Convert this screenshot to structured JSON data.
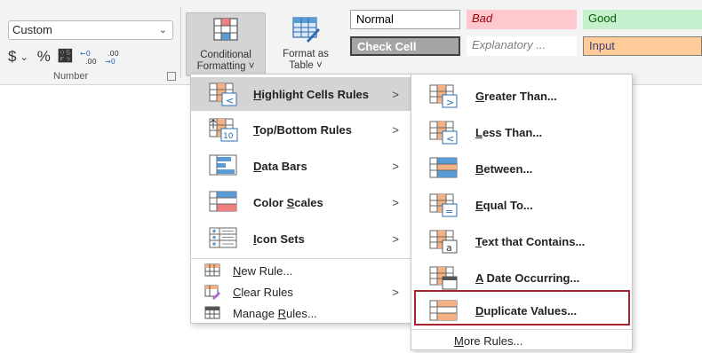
{
  "number_group": {
    "format_value": "Custom",
    "currency_symbol": "$",
    "percent_symbol": "%",
    "comma_symbol": "ȹ",
    "increase_decimal": "←.0 .00",
    "decrease_decimal": ".00 →.0",
    "label": "Number"
  },
  "ribbon": {
    "conditional_formatting_line1": "Conditional",
    "conditional_formatting_line2": "Formatting ˅",
    "format_as_table_line1": "Format as",
    "format_as_table_line2": "Table ˅"
  },
  "styles": {
    "normal": "Normal",
    "bad": "Bad",
    "good": "Good",
    "check_cell": "Check Cell",
    "explanatory": "Explanatory ...",
    "input": "Input"
  },
  "main_menu": {
    "items": [
      {
        "label": "Highlight Cells Rules",
        "accel": "H",
        "rest": "ighlight Cells Rules",
        "icon": "highlight-cells-icon"
      },
      {
        "label": "Top/Bottom Rules",
        "accel": "T",
        "rest": "op/Bottom Rules",
        "icon": "top-bottom-icon"
      },
      {
        "label": "Data Bars",
        "accel": "D",
        "rest": "ata Bars",
        "icon": "data-bars-icon"
      },
      {
        "label": "Color Scales",
        "pre": "Color ",
        "accel": "S",
        "rest": "cales",
        "icon": "color-scales-icon"
      },
      {
        "label": "Icon Sets",
        "accel": "I",
        "rest": "con Sets",
        "icon": "icon-sets-icon"
      },
      {
        "label": "New Rule...",
        "accel": "N",
        "rest": "ew Rule...",
        "icon": "new-rule-icon"
      },
      {
        "label": "Clear Rules",
        "accel": "C",
        "rest": "lear Rules",
        "icon": "clear-rules-icon"
      },
      {
        "label": "Manage Rules...",
        "pre": "Manage ",
        "accel": "R",
        "rest": "ules...",
        "icon": "manage-rules-icon"
      }
    ],
    "arrow": ">"
  },
  "sub_menu": {
    "items": [
      {
        "label": "Greater Than...",
        "accel": "G",
        "rest": "reater Than..."
      },
      {
        "label": "Less Than...",
        "accel": "L",
        "rest": "ess Than..."
      },
      {
        "label": "Between...",
        "accel": "B",
        "rest": "etween..."
      },
      {
        "label": "Equal To...",
        "accel": "E",
        "rest": "qual To..."
      },
      {
        "label": "Text that Contains...",
        "accel": "T",
        "rest": "ext that Contains..."
      },
      {
        "label": "A Date Occurring...",
        "accel": "A",
        "rest": " Date Occurring..."
      },
      {
        "label": "Duplicate Values...",
        "accel": "D",
        "rest": "uplicate Values..."
      }
    ],
    "more_rules": {
      "accel": "M",
      "rest": "ore Rules..."
    }
  },
  "colors": {
    "highlight_bg": "#d4d4d4",
    "selected_border": "#a4262c",
    "orange": "#f4b183",
    "red": "#f08080",
    "blue": "#5b9bd5"
  }
}
